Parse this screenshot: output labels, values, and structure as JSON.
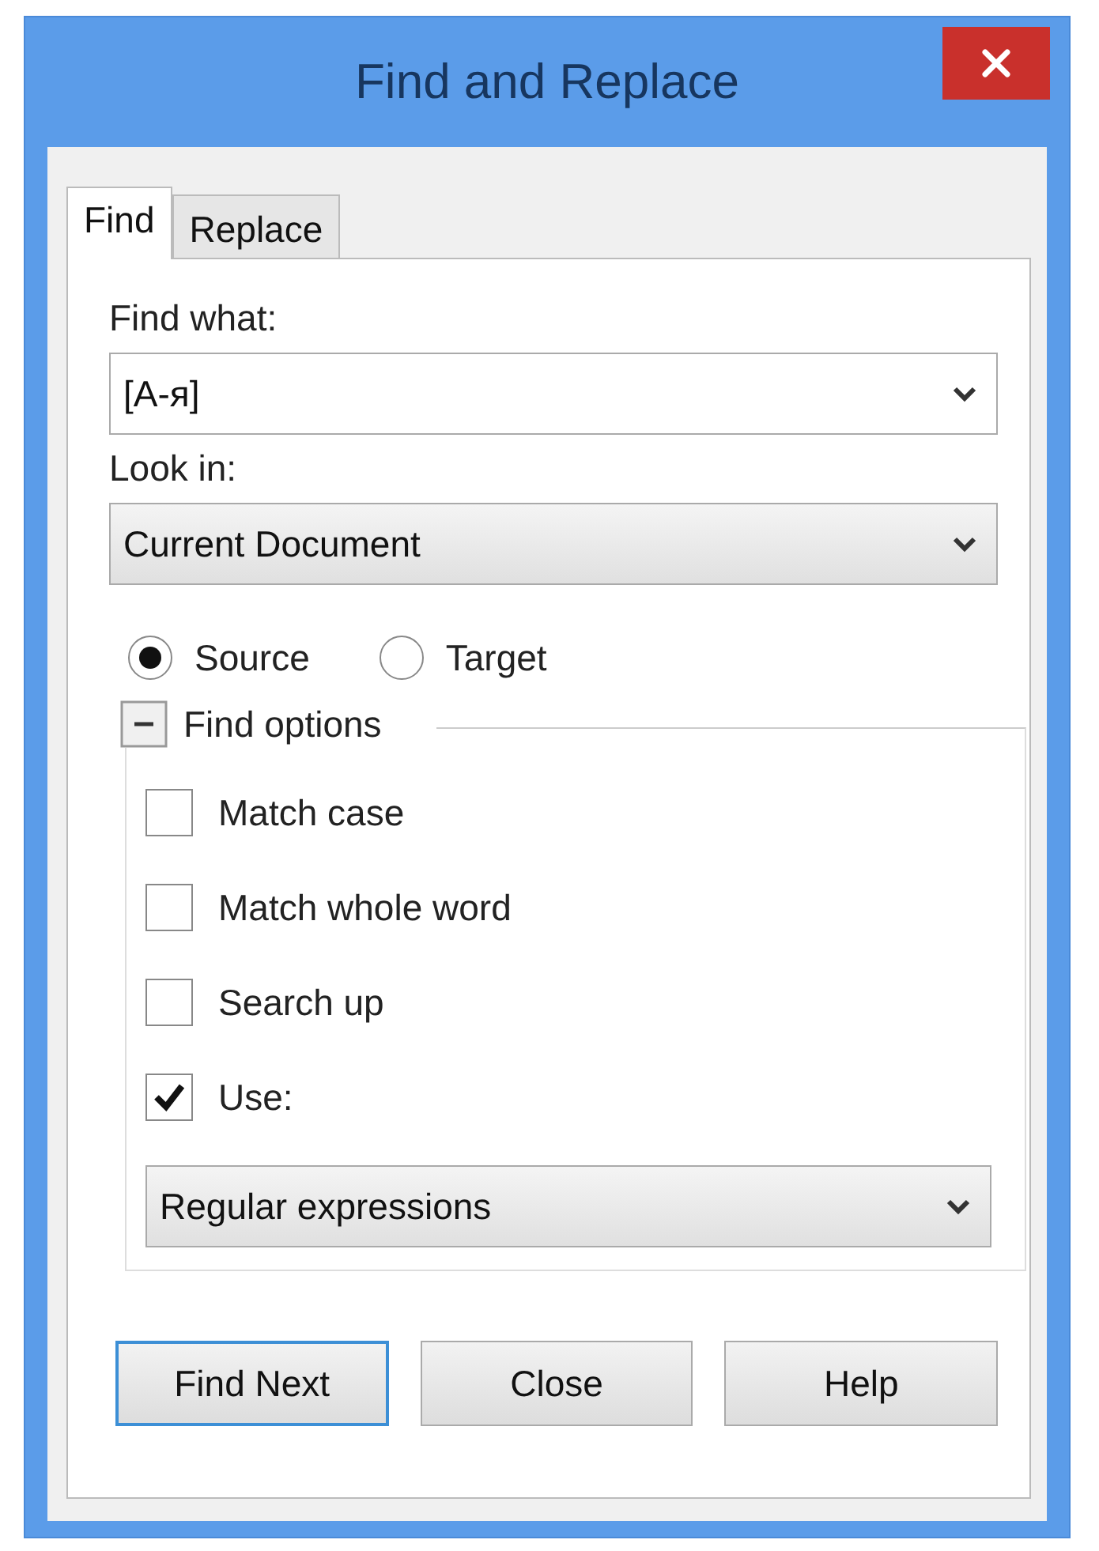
{
  "window": {
    "title": "Find and Replace"
  },
  "tabs": [
    {
      "label": "Find",
      "selected": true
    },
    {
      "label": "Replace",
      "selected": false
    }
  ],
  "find_what": {
    "label": "Find what:",
    "value": "[A-я]"
  },
  "look_in": {
    "label": "Look in:",
    "value": "Current Document"
  },
  "scope": [
    {
      "label": "Source",
      "selected": true
    },
    {
      "label": "Target",
      "selected": false
    }
  ],
  "find_options": {
    "label": "Find options",
    "expanded": true,
    "options": [
      {
        "label": "Match case",
        "checked": false
      },
      {
        "label": "Match whole word",
        "checked": false
      },
      {
        "label": "Search up",
        "checked": false
      },
      {
        "label": "Use:",
        "checked": true
      }
    ],
    "use_type": {
      "value": "Regular expressions"
    }
  },
  "buttons": [
    {
      "label": "Find Next",
      "default": true
    },
    {
      "label": "Close",
      "default": false
    },
    {
      "label": "Help",
      "default": false
    }
  ]
}
